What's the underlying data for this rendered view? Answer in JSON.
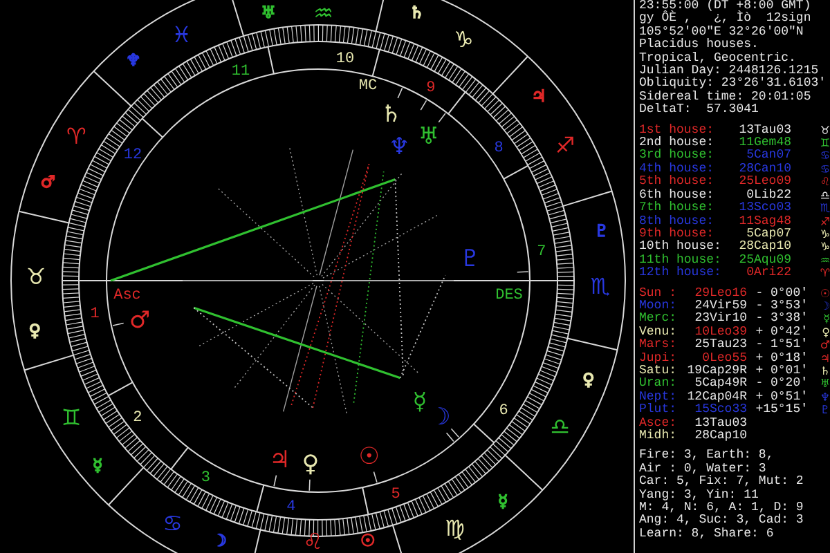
{
  "chart": {
    "signs": [
      {
        "glyph": "♈",
        "color": "#e02828"
      },
      {
        "glyph": "♉",
        "color": "#e8e8b0"
      },
      {
        "glyph": "♊",
        "color": "#30c030"
      },
      {
        "glyph": "♋",
        "color": "#2838e0"
      },
      {
        "glyph": "♌",
        "color": "#e02828"
      },
      {
        "glyph": "♍",
        "color": "#e8e8b0"
      },
      {
        "glyph": "♎",
        "color": "#30c030"
      },
      {
        "glyph": "♏",
        "color": "#2838e0"
      },
      {
        "glyph": "♐",
        "color": "#e02828"
      },
      {
        "glyph": "♑",
        "color": "#e8e8b0"
      },
      {
        "glyph": "♒",
        "color": "#30c030"
      },
      {
        "glyph": "♓",
        "color": "#2838e0"
      }
    ],
    "rulers": [
      {
        "glyph": "♂",
        "color": "#e02828"
      },
      {
        "glyph": "♀",
        "color": "#e8e8b0"
      },
      {
        "glyph": "☿",
        "color": "#30c030"
      },
      {
        "glyph": "☽",
        "color": "#2838e0"
      },
      {
        "glyph": "☉",
        "color": "#e02828"
      },
      {
        "glyph": "☿",
        "color": "#30c030"
      },
      {
        "glyph": "♀",
        "color": "#e8e8b0"
      },
      {
        "glyph": "♇",
        "color": "#2838e0"
      },
      {
        "glyph": "♃",
        "color": "#e02828"
      },
      {
        "glyph": "♄",
        "color": "#e8e8b0"
      },
      {
        "glyph": "♅",
        "color": "#30c030"
      },
      {
        "glyph": "♆",
        "color": "#2838e0"
      }
    ],
    "house_numbers": [
      {
        "label": "1",
        "color": "#e02828"
      },
      {
        "label": "2",
        "color": "#e8e8b0"
      },
      {
        "label": "3",
        "color": "#30c030"
      },
      {
        "label": "4",
        "color": "#2838e0"
      },
      {
        "label": "5",
        "color": "#e02828"
      },
      {
        "label": "6",
        "color": "#e8e8b0"
      },
      {
        "label": "7",
        "color": "#30c030"
      },
      {
        "label": "8",
        "color": "#2838e0"
      },
      {
        "label": "9",
        "color": "#e02828"
      },
      {
        "label": "10",
        "color": "#e8e8b0"
      },
      {
        "label": "11",
        "color": "#30c030"
      },
      {
        "label": "12",
        "color": "#2838e0"
      }
    ],
    "planets": [
      {
        "glyph": "☉",
        "color": "#e02828"
      },
      {
        "glyph": "☽",
        "color": "#2838e0"
      },
      {
        "glyph": "☿",
        "color": "#30c030"
      },
      {
        "glyph": "♀",
        "color": "#e8e8b0"
      },
      {
        "glyph": "♂",
        "color": "#e02828"
      },
      {
        "glyph": "♃",
        "color": "#e02828"
      },
      {
        "glyph": "♄",
        "color": "#e8e8b0"
      },
      {
        "glyph": "♅",
        "color": "#30c030"
      },
      {
        "glyph": "♆",
        "color": "#2838e0"
      },
      {
        "glyph": "♇",
        "color": "#2838e0"
      }
    ],
    "angle_labels": [
      {
        "text": "Asc",
        "color": "#e02828"
      },
      {
        "text": "DES",
        "color": "#30c030"
      },
      {
        "text": "MC",
        "color": "#e8e8b0"
      }
    ],
    "aspects": [
      {
        "kind": "solid",
        "color": "#30c030"
      },
      {
        "kind": "solid",
        "color": "#30c030"
      },
      {
        "kind": "dotted",
        "color": "#c0c0c0"
      },
      {
        "kind": "dotted",
        "color": "#e02828"
      },
      {
        "kind": "dotted",
        "color": "#e02828"
      },
      {
        "kind": "dotted",
        "color": "#30c030"
      },
      {
        "kind": "dotted",
        "color": "#c0c0c0"
      },
      {
        "kind": "dotted",
        "color": "#c0c0c0"
      }
    ]
  },
  "panel": {
    "header": [
      "23:55:00 (DT +8:00 GMT)",
      "gy ÔÈ ,   ¿, Ìò  12sign",
      "105°52'00\"E 32°26'00\"N",
      "Placidus houses.",
      "Tropical, Geocentric.",
      "Julian Day: 2448126.1215",
      "Obliquity: 23°26'31.6103'",
      "Sidereal time: 20:01:05",
      "DeltaT:  57.3041"
    ],
    "houses": [
      {
        "label": "1st house:",
        "color": "#e02828",
        "value": {
          "text": "13Tau03",
          "color": "#e8e8e8"
        },
        "glyph": "♉"
      },
      {
        "label": "2nd house:",
        "color": "#e8e8e8",
        "value": {
          "text": "11Gem48",
          "color": "#30c030"
        },
        "glyph": "♊"
      },
      {
        "label": "3rd house:",
        "color": "#30c030",
        "value": {
          "text": "5Can07",
          "color": "#2838e0"
        },
        "glyph": "♋"
      },
      {
        "label": "4th house:",
        "color": "#2838e0",
        "value": {
          "text": "28Can10",
          "color": "#2838e0"
        },
        "glyph": "♋"
      },
      {
        "label": "5th house:",
        "color": "#e02828",
        "value": {
          "text": "25Leo09",
          "color": "#e02828"
        },
        "glyph": "♌"
      },
      {
        "label": "6th house:",
        "color": "#e8e8e8",
        "value": {
          "text": "0Lib22",
          "color": "#e8e8e8"
        },
        "glyph": "♎"
      },
      {
        "label": "7th house:",
        "color": "#30c030",
        "value": {
          "text": "13Sco03",
          "color": "#2838e0"
        },
        "glyph": "♏"
      },
      {
        "label": "8th house:",
        "color": "#2838e0",
        "value": {
          "text": "11Sag48",
          "color": "#e02828"
        },
        "glyph": "♐"
      },
      {
        "label": "9th house:",
        "color": "#e02828",
        "value": {
          "text": "5Cap07",
          "color": "#e8e8b0"
        },
        "glyph": "♑"
      },
      {
        "label": "10th house:",
        "color": "#e8e8e8",
        "value": {
          "text": "28Cap10",
          "color": "#e8e8b0"
        },
        "glyph": "♑"
      },
      {
        "label": "11th house:",
        "color": "#30c030",
        "value": {
          "text": "25Aqu09",
          "color": "#30c030"
        },
        "glyph": "♒"
      },
      {
        "label": "12th house:",
        "color": "#2838e0",
        "value": {
          "text": "0Ari22",
          "color": "#e02828"
        },
        "glyph": "♈"
      }
    ],
    "planets": [
      {
        "label": "Sun :",
        "color": "#e02828",
        "value": {
          "text": "29Leo16",
          "color": "#e02828"
        },
        "speed": "- 0°00'",
        "glyph": "☉"
      },
      {
        "label": "Moon:",
        "color": "#2838e0",
        "value": {
          "text": "24Vir59",
          "color": "#e8e8e8"
        },
        "speed": "- 3°53'",
        "glyph": "☽"
      },
      {
        "label": "Merc:",
        "color": "#30c030",
        "value": {
          "text": "23Vir10",
          "color": "#e8e8e8"
        },
        "speed": "- 3°38'",
        "glyph": "☿"
      },
      {
        "label": "Venu:",
        "color": "#e8e8b0",
        "value": {
          "text": "10Leo39",
          "color": "#e02828"
        },
        "speed": "+ 0°42'",
        "glyph": "♀"
      },
      {
        "label": "Mars:",
        "color": "#e02828",
        "value": {
          "text": "25Tau23",
          "color": "#e8e8e8"
        },
        "speed": "- 1°51'",
        "glyph": "♂"
      },
      {
        "label": "Jupi:",
        "color": "#e02828",
        "value": {
          "text": "0Leo55",
          "color": "#e02828"
        },
        "speed": "+ 0°18'",
        "glyph": "♃"
      },
      {
        "label": "Satu:",
        "color": "#e8e8b0",
        "value": {
          "text": "19Cap29R",
          "color": "#e8e8e8"
        },
        "speed": "+ 0°01'",
        "glyph": "♄"
      },
      {
        "label": "Uran:",
        "color": "#30c030",
        "value": {
          "text": "5Cap49R",
          "color": "#e8e8e8"
        },
        "speed": "- 0°20'",
        "glyph": "♅"
      },
      {
        "label": "Nept:",
        "color": "#2838e0",
        "value": {
          "text": "12Cap04R",
          "color": "#e8e8e8"
        },
        "speed": "+ 0°51'",
        "glyph": "♆"
      },
      {
        "label": "Plut:",
        "color": "#2838e0",
        "value": {
          "text": "15Sco33",
          "color": "#2838e0"
        },
        "speed": "+15°15'",
        "glyph": "♇"
      },
      {
        "label": "Asce:",
        "color": "#e02828",
        "value": {
          "text": "13Tau03",
          "color": "#e8e8e8"
        }
      },
      {
        "label": "Midh:",
        "color": "#e8e8b0",
        "value": {
          "text": "28Cap10",
          "color": "#e8e8e8"
        }
      }
    ],
    "stats": [
      "Fire: 3, Earth: 8,",
      "Air : 0, Water: 3",
      "Car: 5, Fix: 7, Mut: 2",
      "Yang: 3, Yin: 11",
      "M: 4, N: 6, A: 1, D: 9",
      "Ang: 4, Suc: 3, Cad: 3",
      "Learn: 8, Share: 6"
    ]
  }
}
